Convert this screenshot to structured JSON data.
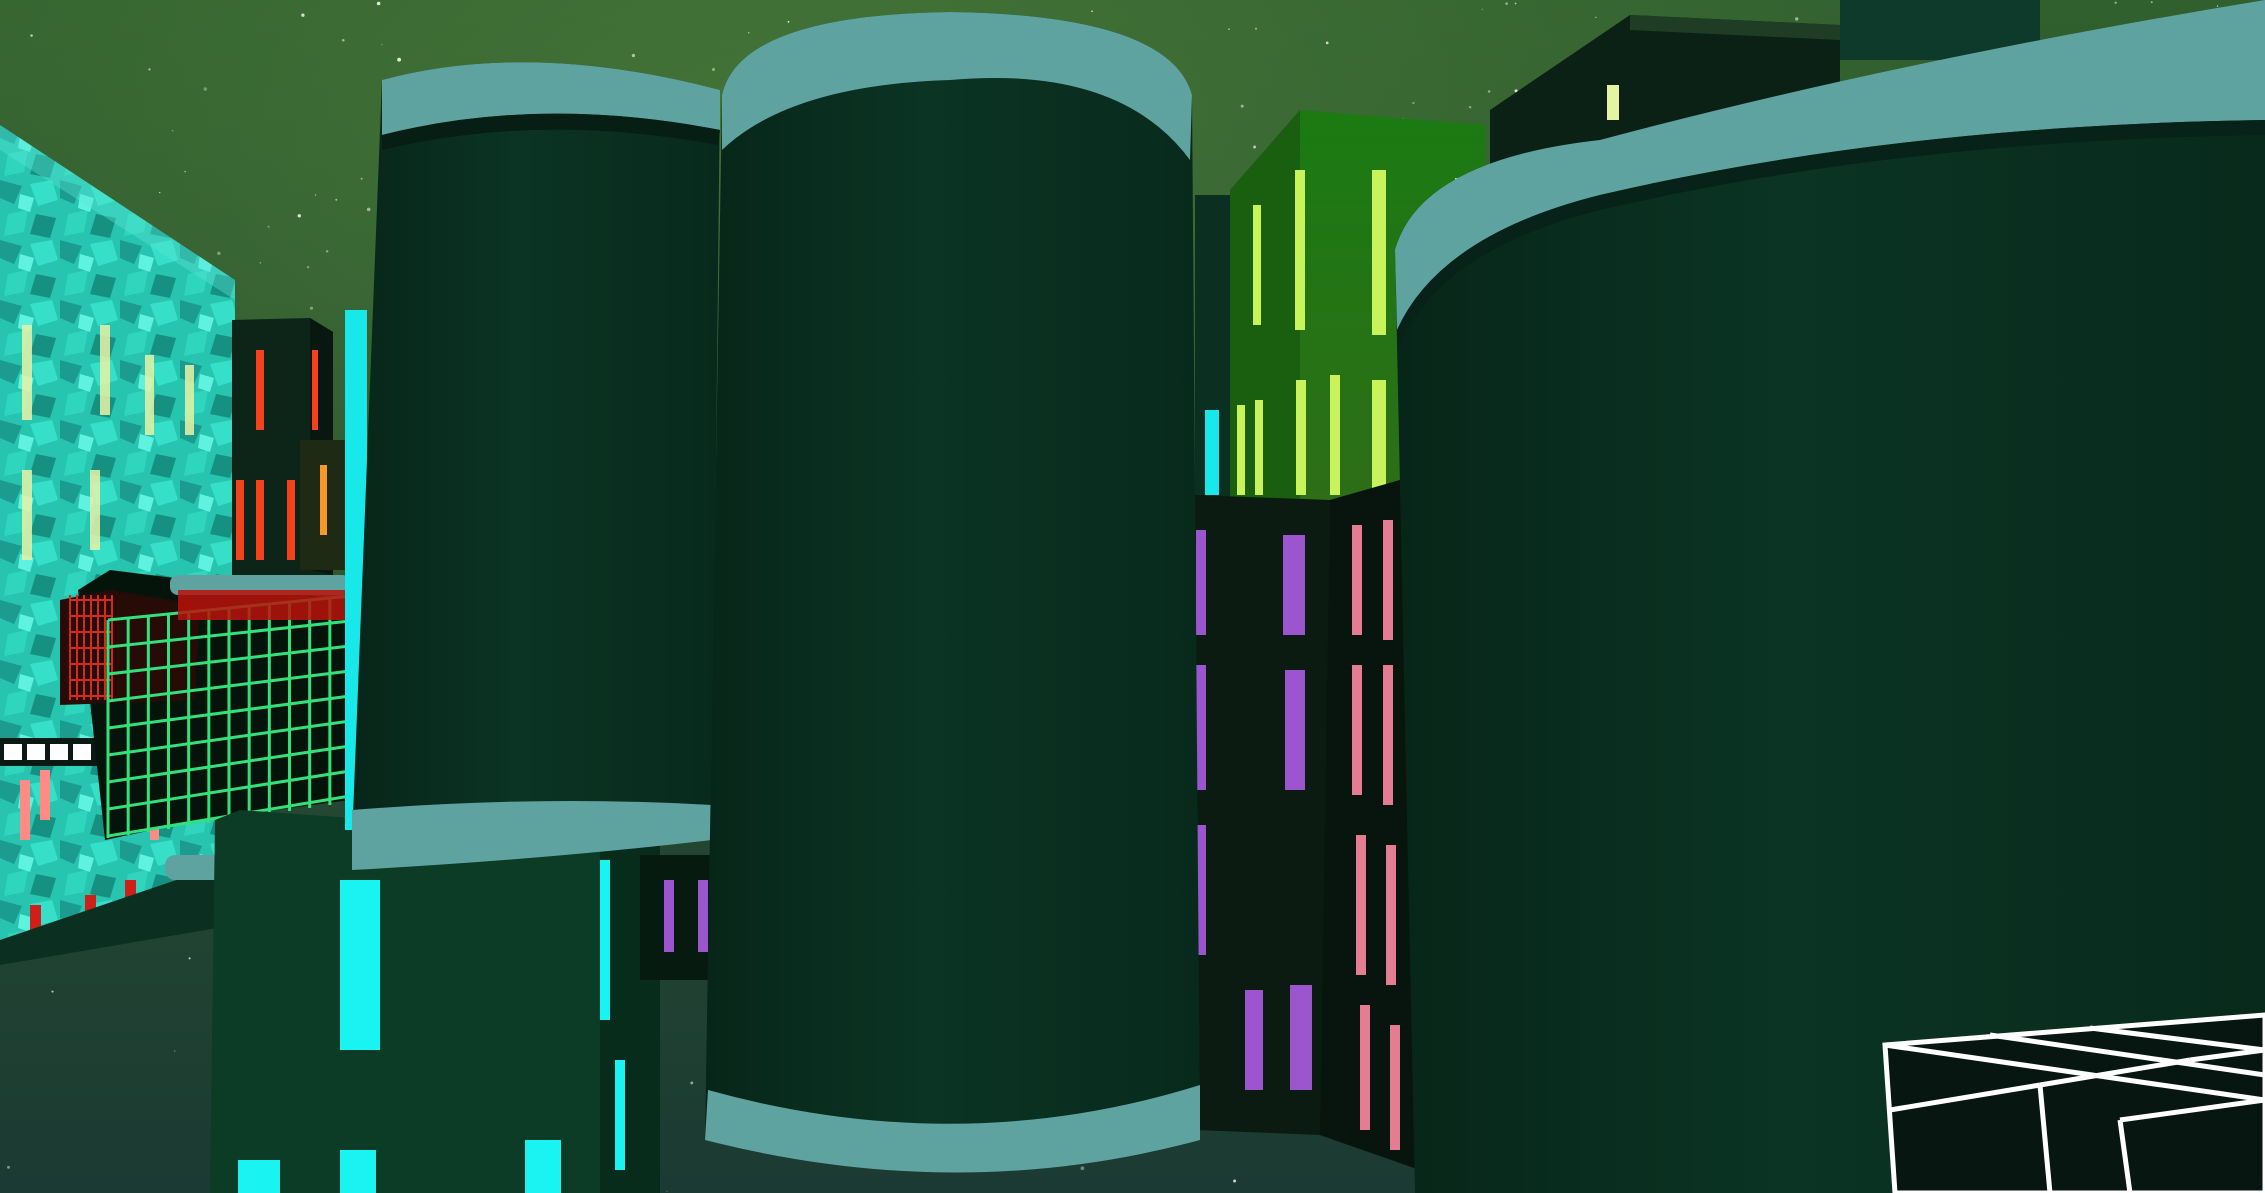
{
  "scene": {
    "kind": "3d-city-flythrough",
    "hud_text": "",
    "colors": {
      "sky_top": "#2c5a2c",
      "sky_bottom": "#1d3f31",
      "pillar_body": "#0a2e1e",
      "pillar_ring": "#5fa3a1",
      "window_cyan": "#19f3f1",
      "window_purple": "#9a55cf",
      "window_pink": "#e57d92",
      "window_lime": "#c8f35a",
      "window_red": "#f3472b",
      "grid_green": "#34e17c",
      "grid_white": "#ffffff",
      "mosaic_cyan": "#24c9b5"
    },
    "objects": [
      "mosaic-building",
      "green-grid-building",
      "red-window-tower",
      "cylindrical-pillar-left",
      "cylindrical-pillar-center",
      "cylindrical-pillar-right",
      "lime-window-tower",
      "purple-pink-window-tower",
      "dark-tower-top",
      "white-grid-platform",
      "lower-cyan-window-tower"
    ]
  }
}
